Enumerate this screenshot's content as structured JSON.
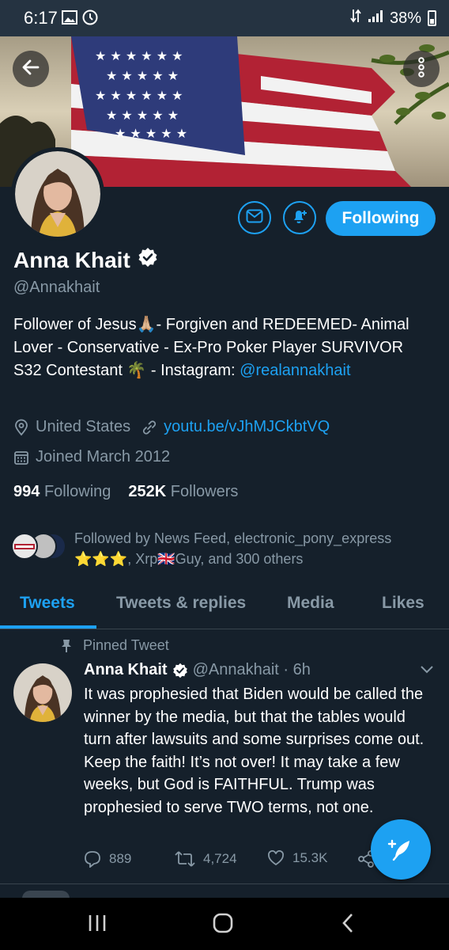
{
  "status_bar": {
    "time": "6:17",
    "battery": "38%"
  },
  "profile": {
    "name": "Anna Khait",
    "handle": "@Annakhait",
    "following_button": "Following",
    "bio_text": "Follower of Jesus🙏🏼- Forgiven and REDEEMED- Animal Lover - Conservative - Ex-Pro Poker Player SURVIVOR S32 Contestant 🌴 - Instagram: ",
    "bio_link": "@realannakhait",
    "location": "United States",
    "website": "youtu.be/vJhMJCkbtVQ",
    "joined": "Joined March 2012",
    "following_count": "994",
    "following_label": "Following",
    "followers_count": "252K",
    "followers_label": "Followers",
    "followed_by": "Followed by News Feed, electronic_pony_express ⭐⭐⭐, Xrp🇬🇧Guy, and 300 others"
  },
  "tabs": [
    "Tweets",
    "Tweets & replies",
    "Media",
    "Likes"
  ],
  "tweet": {
    "pinned_label": "Pinned Tweet",
    "author": "Anna Khait",
    "meta": "@Annakhait · 6h",
    "text": "It was prophesied that Biden would be called the winner by the media, but that the tables would turn after lawsuits and some surprises come out. Keep the faith! It’s not over! It may take a few weeks, but God is FAITHFUL. Trump was prophesied to serve TWO terms, not one.",
    "replies": "889",
    "retweets": "4,724",
    "likes": "15.3K"
  },
  "colors": {
    "accent": "#1da1f2",
    "background": "#15202b",
    "muted": "#8899a6"
  },
  "icons": [
    "back-arrow-icon",
    "more-vertical-icon",
    "mail-icon",
    "bell-plus-icon",
    "verified-icon",
    "location-icon",
    "link-icon",
    "calendar-icon",
    "pin-icon",
    "chevron-down-icon",
    "reply-icon",
    "retweet-icon",
    "heart-icon",
    "share-icon",
    "compose-feather-icon"
  ]
}
